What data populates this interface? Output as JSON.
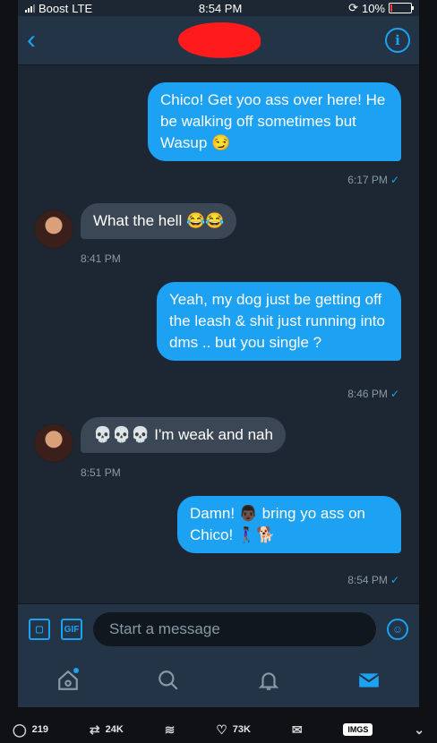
{
  "status": {
    "carrier": "Boost",
    "network": "LTE",
    "time": "8:54 PM",
    "battery_pct": "10%",
    "battery_level": 0.1
  },
  "nav": {
    "back_icon": "chevron-left-icon",
    "info_icon": "info-icon"
  },
  "messages": [
    {
      "side": "sent",
      "text": "Chico! Get yoo ass over here! He be walking off sometimes but Wasup 😏",
      "time": "6:17 PM"
    },
    {
      "side": "recv",
      "text": "What the hell 😂😂",
      "time": "8:41 PM"
    },
    {
      "side": "sent",
      "text": "Yeah, my dog just be getting off the leash & shit just running into dms .. but you single ?",
      "time": "8:46 PM"
    },
    {
      "side": "recv",
      "text": "💀💀💀 I'm weak and nah",
      "time": "8:51 PM"
    },
    {
      "side": "sent",
      "text": "Damn! 👨🏿 bring yo ass on Chico! 🚶🏿‍♀️🐕",
      "time": "8:54 PM"
    }
  ],
  "composer": {
    "placeholder": "Start a message",
    "gif_label": "GIF"
  },
  "tabs": [
    "home-icon",
    "search-icon",
    "bell-icon",
    "mail-icon"
  ],
  "footer": {
    "replies": "219",
    "retweets": "24K",
    "likes": "73K",
    "imgs_label": "IMGS"
  },
  "colors": {
    "accent": "#1da1f2",
    "background": "#1c2733",
    "received_bubble": "#3b4754"
  }
}
